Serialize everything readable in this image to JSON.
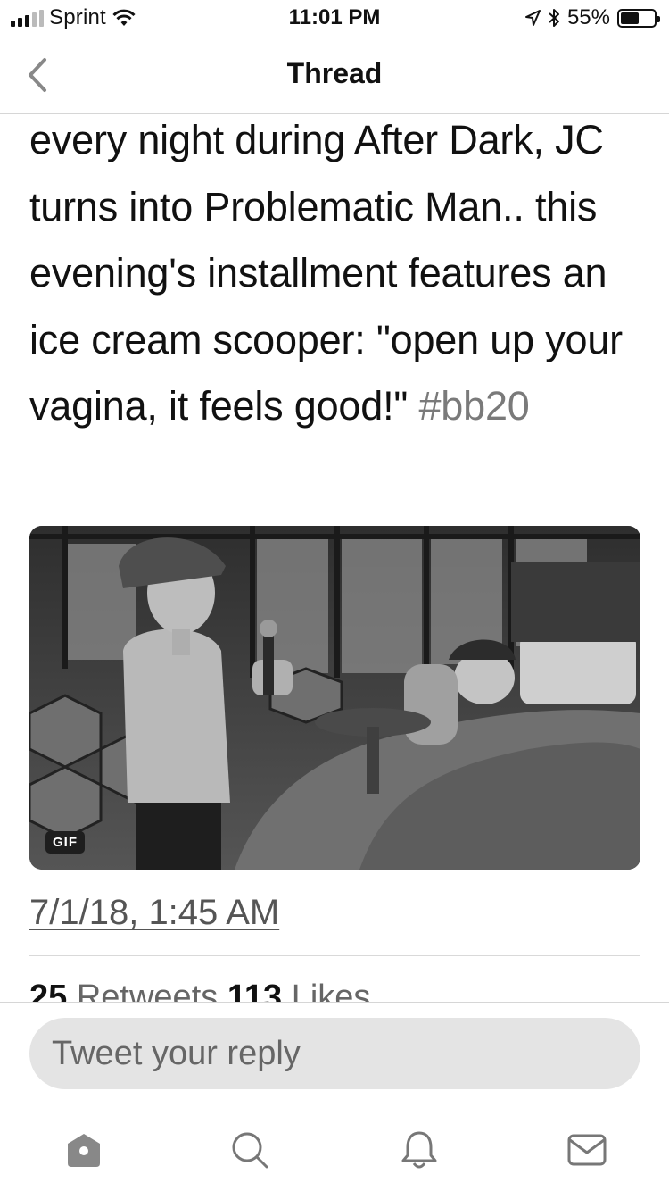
{
  "status_bar": {
    "carrier": "Sprint",
    "time": "11:01 PM",
    "battery": "55%",
    "battery_level": 0.55,
    "icons": [
      "signal-icon",
      "wifi-icon",
      "location-icon",
      "bluetooth-icon",
      "battery-icon"
    ]
  },
  "nav": {
    "title": "Thread",
    "back_icon": "chevron-left-icon"
  },
  "tweet": {
    "text": "every night during After Dark, JC turns into Problematic Man.. this evening's installment features an ice cream scooper: \"open up your vagina, it feels good!\" ",
    "hashtag": "#bb20",
    "media_badge": "GIF",
    "timestamp": "7/1/18, 1:45 AM",
    "retweets_count": "25",
    "retweets_label": "Retweets",
    "likes_count": "113",
    "likes_label": "Likes"
  },
  "reply": {
    "placeholder": "Tweet your reply"
  },
  "tab_bar": {
    "items": [
      "home-icon",
      "search-icon",
      "notifications-icon",
      "messages-icon"
    ],
    "active": "home-icon"
  },
  "colors": {
    "text": "#111111",
    "secondary": "#666666",
    "hashtag": "#7a7a7a",
    "input_bg": "#e4e4e4",
    "divider": "#d6d6d6"
  }
}
